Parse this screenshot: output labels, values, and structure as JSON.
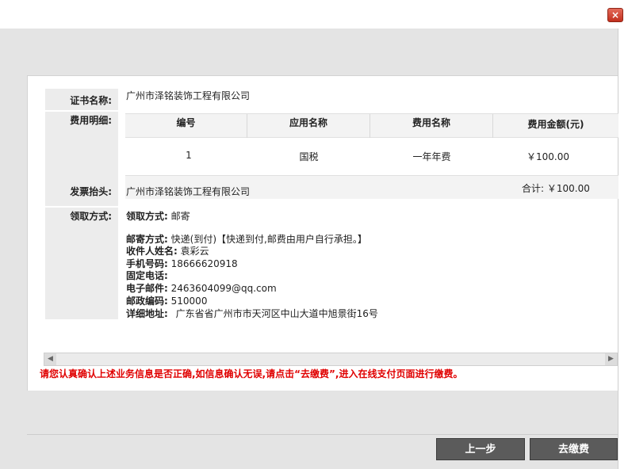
{
  "window": {
    "close_icon": "×"
  },
  "cert": {
    "label": "证书名称:",
    "value": "广州市泽铭装饰工程有限公司"
  },
  "fee": {
    "label": "费用明细:",
    "columns": [
      "编号",
      "应用名称",
      "费用名称",
      "费用金额(元)"
    ],
    "rows": [
      {
        "no": "1",
        "app": "国税",
        "fee_name": "一年年费",
        "amount": "￥100.00"
      }
    ],
    "total": "合计: ￥100.00"
  },
  "invoice": {
    "label": "发票抬头:",
    "value": "广州市泽铭装饰工程有限公司"
  },
  "pickup": {
    "label": "领取方式:",
    "method_label": "领取方式:",
    "method_value": "邮寄",
    "post_label": "邮寄方式:",
    "post_value": "快递(到付)【快递到付,邮费由用户自行承担。】",
    "name_label": "收件人姓名:",
    "name_value": "袁彩云",
    "phone_label": "手机号码:",
    "phone_value": "18666620918",
    "tel_label": "固定电话:",
    "tel_value": "",
    "email_label": "电子邮件:",
    "email_value": "2463604099@qq.com",
    "zip_label": "邮政编码:",
    "zip_value": "510000",
    "addr_label": "详细地址:",
    "addr_value": "广东省省广州市市天河区中山大道中旭景街16号"
  },
  "warning": "请您认真确认上述业务信息是否正确,如信息确认无误,请点击“去缴费”,进入在线支付页面进行缴费。",
  "buttons": {
    "prev": "上一步",
    "pay": "去缴费"
  },
  "colors": {
    "warning": "#e00000",
    "button_bg": "#5b5b5b",
    "close_bg": "#c22f1d"
  }
}
